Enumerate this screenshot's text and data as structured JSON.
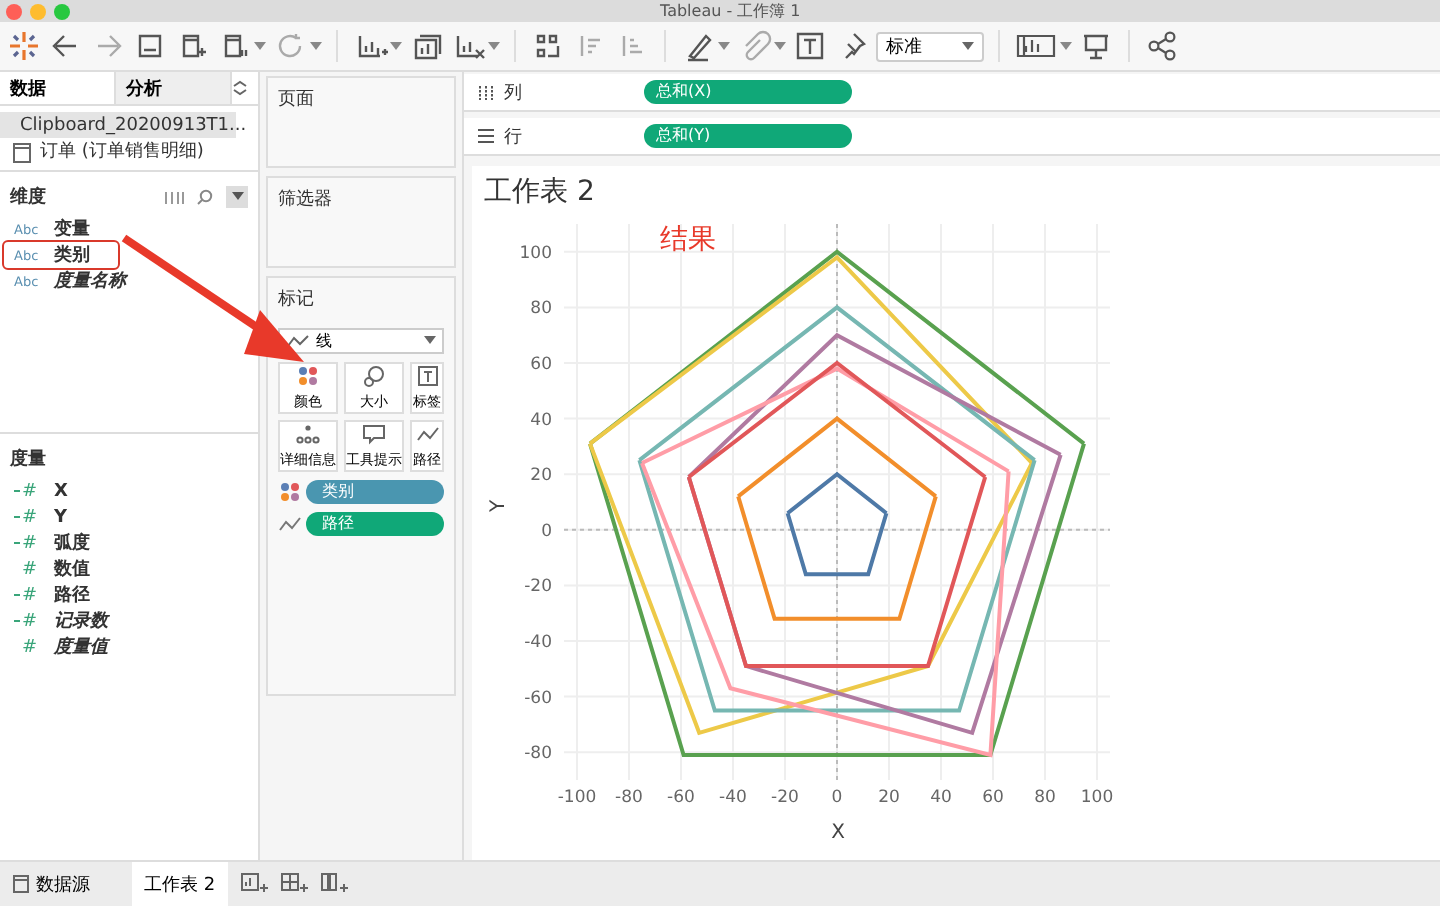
{
  "window": {
    "title": "Tableau - 工作簿 1"
  },
  "toolbar": {
    "fit_dropdown": "标准"
  },
  "data_pane": {
    "tabs": [
      {
        "label": "数据",
        "selected": true
      },
      {
        "label": "分析",
        "selected": false
      }
    ],
    "datasources": [
      {
        "name": "Clipboard_20200913T1...",
        "selected": true
      },
      {
        "name": "订单 (订单销售明细)",
        "selected": false
      }
    ],
    "dimensions": {
      "title": "维度",
      "fields": [
        {
          "type": "Abc",
          "name": "变量",
          "calculated": false,
          "highlighted": false
        },
        {
          "type": "Abc",
          "name": "类别",
          "calculated": false,
          "highlighted": true
        },
        {
          "type": "Abc",
          "name": "度量名称",
          "calculated": true,
          "highlighted": false
        }
      ]
    },
    "measures": {
      "title": "度量",
      "fields": [
        {
          "type": "#",
          "kind": "continuous",
          "name": "X",
          "calculated": false
        },
        {
          "type": "#",
          "kind": "continuous",
          "name": "Y",
          "calculated": false
        },
        {
          "type": "#",
          "kind": "continuous",
          "name": "弧度",
          "calculated": false
        },
        {
          "type": "#",
          "kind": "plain",
          "name": "数值",
          "calculated": false
        },
        {
          "type": "#",
          "kind": "continuous",
          "name": "路径",
          "calculated": false
        },
        {
          "type": "#",
          "kind": "continuous",
          "name": "记录数",
          "calculated": true
        },
        {
          "type": "#",
          "kind": "plain",
          "name": "度量值",
          "calculated": true
        }
      ]
    }
  },
  "pages_shelf": {
    "title": "页面"
  },
  "filters_shelf": {
    "title": "筛选器"
  },
  "marks_card": {
    "title": "标记",
    "mark_type": "线",
    "buttons": [
      {
        "kind": "color",
        "label": "颜色"
      },
      {
        "kind": "size",
        "label": "大小"
      },
      {
        "kind": "label",
        "label": "标签"
      },
      {
        "kind": "detail",
        "label": "详细信息"
      },
      {
        "kind": "tooltip",
        "label": "工具提示"
      },
      {
        "kind": "path",
        "label": "路径"
      }
    ],
    "pills": [
      {
        "kind": "color",
        "label": "类别"
      },
      {
        "kind": "path",
        "label": "路径"
      }
    ]
  },
  "columns_shelf": {
    "label": "列",
    "pill": "总和(X)"
  },
  "rows_shelf": {
    "label": "行",
    "pill": "总和(Y)"
  },
  "sheet": {
    "title": "工作表 2",
    "annotation": "结果",
    "chart_data": {
      "type": "line",
      "grid": true,
      "xlabel": "X",
      "ylabel": "Y",
      "xlim": [
        -105,
        105
      ],
      "ylim": [
        -90,
        110
      ],
      "xticks": [
        -100,
        -80,
        -60,
        -40,
        -20,
        0,
        20,
        40,
        60,
        80,
        100
      ],
      "yticks": [
        -80,
        -60,
        -40,
        -20,
        0,
        20,
        40,
        60,
        80,
        100
      ],
      "series": [
        {
          "color": "#59a14f",
          "x": [
            -95,
            0,
            95
          ],
          "values": [
            31,
            100,
            31
          ]
        },
        {
          "color": "#59a14f",
          "x": [
            -95,
            -59,
            59,
            95
          ],
          "values": [
            31,
            -81,
            -81,
            31
          ]
        },
        {
          "color": "#edc948",
          "x": [
            -95,
            0,
            75
          ],
          "values": [
            31,
            98,
            24
          ]
        },
        {
          "color": "#edc948",
          "x": [
            -95,
            -53,
            35,
            75
          ],
          "values": [
            31,
            -73,
            -49,
            24
          ]
        },
        {
          "color": "#76b7b2",
          "x": [
            -76,
            0,
            76
          ],
          "values": [
            25,
            80,
            25
          ]
        },
        {
          "color": "#76b7b2",
          "x": [
            -76,
            -47,
            47,
            76
          ],
          "values": [
            25,
            -65,
            -65,
            25
          ]
        },
        {
          "color": "#b07aa1",
          "x": [
            -57,
            0,
            86
          ],
          "values": [
            19,
            70,
            27
          ]
        },
        {
          "color": "#b07aa1",
          "x": [
            -57,
            -35,
            52,
            86
          ],
          "values": [
            19,
            -49,
            -73,
            27
          ]
        },
        {
          "color": "#ff9da7",
          "x": [
            -75,
            0,
            66
          ],
          "values": [
            24,
            58,
            21
          ]
        },
        {
          "color": "#ff9da7",
          "x": [
            -75,
            -41,
            59,
            66
          ],
          "values": [
            24,
            -57,
            -81,
            21
          ]
        },
        {
          "color": "#e15759",
          "x": [
            -57,
            0,
            57
          ],
          "values": [
            19,
            60,
            19
          ]
        },
        {
          "color": "#e15759",
          "x": [
            -57,
            -35,
            35,
            57
          ],
          "values": [
            19,
            -49,
            -49,
            19
          ]
        },
        {
          "color": "#f28e2b",
          "x": [
            -38,
            0,
            38
          ],
          "values": [
            12,
            40,
            12
          ]
        },
        {
          "color": "#f28e2b",
          "x": [
            -38,
            -24,
            24,
            38
          ],
          "values": [
            12,
            -32,
            -32,
            12
          ]
        },
        {
          "color": "#4e79a7",
          "x": [
            -19,
            0,
            19
          ],
          "values": [
            6,
            20,
            6
          ]
        },
        {
          "color": "#4e79a7",
          "x": [
            -19,
            -12,
            12,
            19
          ],
          "values": [
            6,
            -16,
            -16,
            6
          ]
        }
      ]
    }
  },
  "bottom_tabs": [
    {
      "kind": "datasource",
      "label": "数据源",
      "selected": false
    },
    {
      "kind": "sheet",
      "label": "工作表 2",
      "selected": true
    }
  ]
}
